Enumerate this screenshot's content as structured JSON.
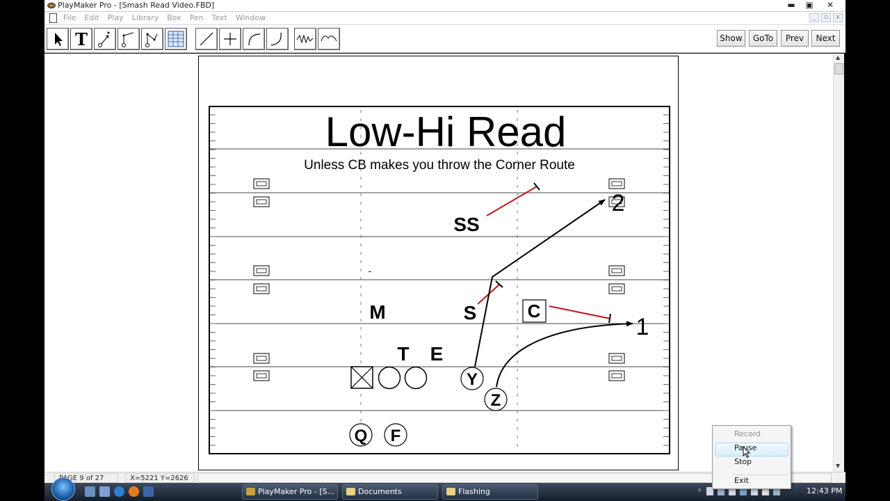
{
  "window": {
    "title": "PlayMaker Pro - [Smash Read Video.FBD]",
    "minimize_glyph": "▬",
    "maximize_glyph": "▣",
    "close_glyph": "✕"
  },
  "menu": {
    "items": [
      "File",
      "Edit",
      "Play",
      "Library",
      "Box",
      "Pen",
      "Text",
      "Window"
    ]
  },
  "toolbar": {
    "tools": [
      "select-arrow-icon",
      "text-tool-icon",
      "route-point-icon",
      "route-corner-icon",
      "route-zigzag-icon",
      "grid-table-icon",
      "line-tool-icon",
      "plus-tool-icon",
      "curve-tool-icon",
      "hook-curve-icon",
      "zigzag-line-icon",
      "loop-line-icon"
    ],
    "text_tool_glyph": "T",
    "show_label": "Show",
    "goto_label": "GoTo",
    "prev_label": "Prev",
    "next_label": "Next"
  },
  "play": {
    "title": "Low-Hi Read",
    "subtitle": "Unless CB makes you throw the Corner Route",
    "defenders": {
      "ss": "SS",
      "s": "S",
      "m": "M",
      "t": "T",
      "e": "E",
      "c": "C"
    },
    "offense": {
      "y": "Y",
      "z": "Z",
      "q": "Q",
      "f": "F"
    },
    "route_numbers": {
      "first": "1",
      "second": "2"
    },
    "hash_mark": "-",
    "colors": {
      "defender_route": "#c0141c",
      "offense_route": "#000000"
    }
  },
  "status": {
    "page": "PAGE 9 of 27",
    "coords": "X=5221 Y=2626"
  },
  "taskbar": {
    "buttons": [
      "PlayMaker Pro - [S...",
      "Documents",
      "Flashing"
    ],
    "clock": "12:43 PM"
  },
  "context_menu": {
    "record": "Record",
    "pause": "Pause",
    "stop": "Stop",
    "exit": "Exit"
  }
}
